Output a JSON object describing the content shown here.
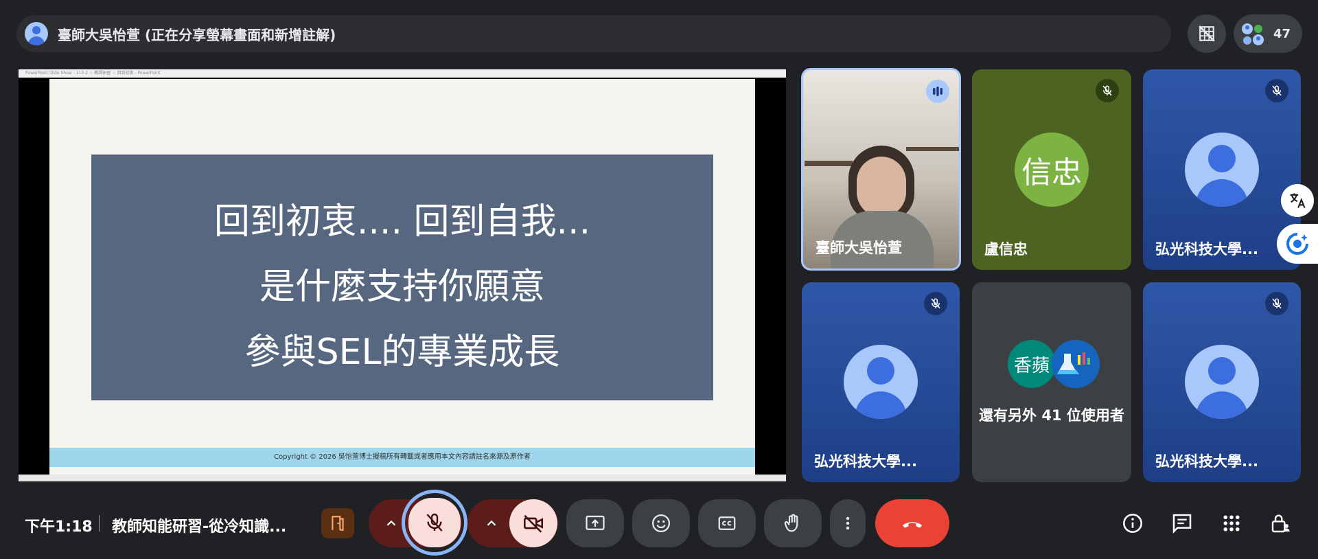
{
  "top_bar": {
    "presenter_text": "臺師大吳怡萱 (正在分享螢幕畫面和新增註解)",
    "participant_count": "47"
  },
  "shared_screen": {
    "window_title": "PowerPoint Slide Show - 113-2 ☆ 教師研習 ☆ 回到初衷 - PowerPoint",
    "slide_lines": [
      "回到初衷.... 回到自我...",
      "是什麼支持你願意",
      "參與SEL的專業成長"
    ],
    "footer": "Copyright © 2026 吳怡萱博士擬稿所有轉載或者應用本文內容請註名來源及原作者"
  },
  "tiles": [
    {
      "name": "臺師大吳怡萱"
    },
    {
      "name": "盧信忠",
      "initials": "信忠"
    },
    {
      "name": "弘光科技大學..."
    },
    {
      "name": "弘光科技大學..."
    },
    {
      "name": "還有另外 41 位使用者",
      "initials": "香蘋"
    },
    {
      "name": "弘光科技大學..."
    }
  ],
  "bottom_bar": {
    "clock": "下午1:18",
    "meeting_title": "教師知能研習-從冷知識..."
  },
  "colors": {
    "background": "#202124",
    "mic_off_bg": "#f9dedc",
    "leave_red": "#ea4335",
    "active_ring": "#8ab4f8",
    "tile_blue": "#2f57a8",
    "slide_box": "#56677f"
  }
}
